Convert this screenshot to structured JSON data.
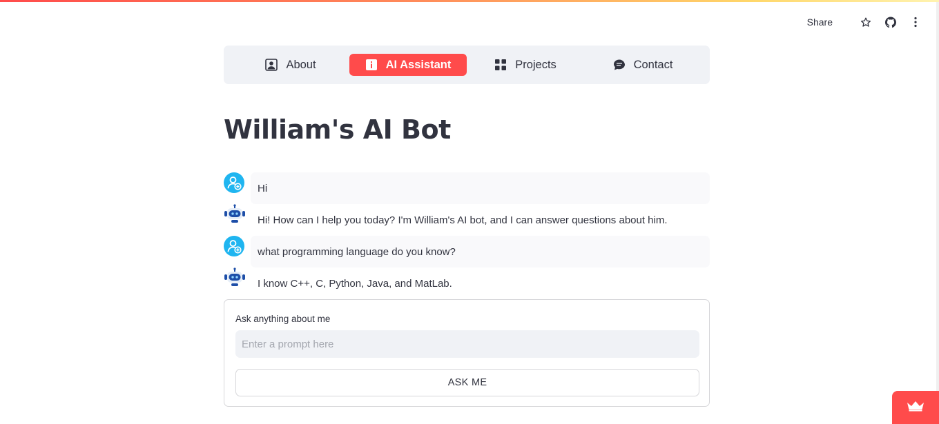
{
  "toolbar": {
    "share_label": "Share",
    "icons": [
      "star-icon",
      "github-icon",
      "more-vertical-icon"
    ]
  },
  "nav": {
    "items": [
      {
        "label": "About",
        "icon": "user-portrait-icon",
        "active": false
      },
      {
        "label": "AI Assistant",
        "icon": "info-box-icon",
        "active": true
      },
      {
        "label": "Projects",
        "icon": "grid-icon",
        "active": false
      },
      {
        "label": "Contact",
        "icon": "chat-bubble-icon",
        "active": false
      }
    ],
    "active_color": "#ff4b4b"
  },
  "page_title": "William's AI Bot",
  "chat": {
    "messages": [
      {
        "role": "user",
        "avatar": "user-add-avatar-icon",
        "text": "Hi"
      },
      {
        "role": "assistant",
        "avatar": "robot-avatar-icon",
        "text": "Hi! How can I help you today? I'm William's AI bot, and I can answer questions about him."
      },
      {
        "role": "user",
        "avatar": "user-add-avatar-icon",
        "text": "what programming language do you know?"
      },
      {
        "role": "assistant",
        "avatar": "robot-avatar-icon",
        "text": "I know C++, C, Python, Java, and MatLab."
      }
    ]
  },
  "form": {
    "label": "Ask anything about me",
    "input_value": "",
    "input_placeholder": "Enter a prompt here",
    "submit_label": "ASK ME"
  },
  "footer_cut_text": "...",
  "deploy_badge": {
    "icon": "crown-icon",
    "color": "#ff4b4b"
  },
  "colors": {
    "accent": "#ff4b4b",
    "nav_bg": "#f0f2f6",
    "text": "#31333f"
  }
}
